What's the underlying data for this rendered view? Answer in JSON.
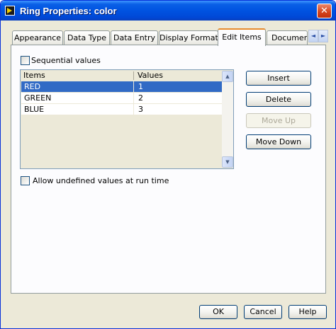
{
  "window": {
    "title": "Ring Properties: color",
    "close_symbol": "✕"
  },
  "tabs": [
    {
      "label": "Appearance"
    },
    {
      "label": "Data Type"
    },
    {
      "label": "Data Entry"
    },
    {
      "label": "Display Format"
    },
    {
      "label": "Edit Items",
      "active": true
    },
    {
      "label": "Documenta"
    }
  ],
  "tab_scroll": {
    "left_symbol": "◄",
    "right_symbol": "►"
  },
  "edit_items": {
    "sequential_values_label": "Sequential values",
    "sequential_values_checked": false,
    "table": {
      "columns": [
        "Items",
        "Values"
      ],
      "rows": [
        {
          "item": "RED",
          "value": "1",
          "selected": true
        },
        {
          "item": "GREEN",
          "value": "2"
        },
        {
          "item": "BLUE",
          "value": "3"
        }
      ]
    },
    "scroll_up_symbol": "▲",
    "scroll_down_symbol": "▼",
    "allow_undefined_label": "Allow undefined values at run time",
    "allow_undefined_checked": false,
    "buttons": {
      "insert": "Insert",
      "delete": "Delete",
      "move_up": "Move Up",
      "move_down": "Move Down"
    }
  },
  "footer": {
    "ok": "OK",
    "cancel": "Cancel",
    "help": "Help"
  },
  "colors": {
    "title_bar": "#0053e1",
    "selection": "#316ac5",
    "active_tab_accent": "#e68b2c",
    "dialog_face": "#ece9d8"
  }
}
